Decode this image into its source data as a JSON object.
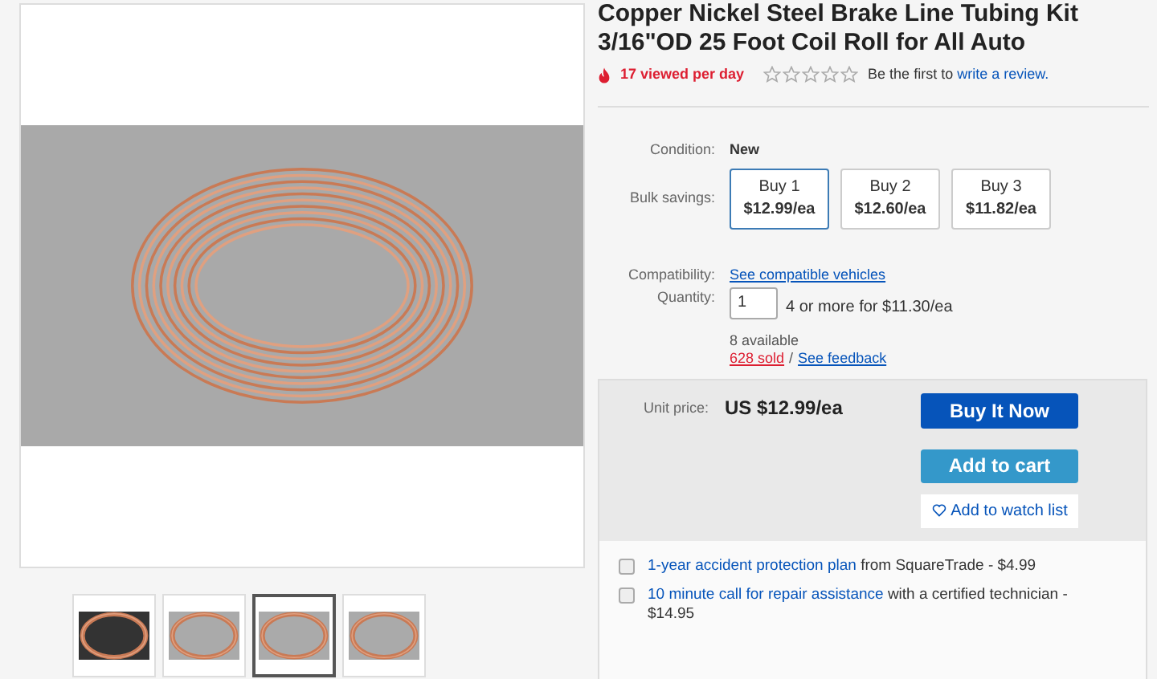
{
  "title": "Copper Nickel Steel Brake Line Tubing Kit 3/16\"OD 25 Foot Coil Roll for All Auto",
  "views": "17 viewed per day",
  "stars": 0,
  "review_prefix": "Be the first to",
  "review_link": "write a review.",
  "condition": {
    "label": "Condition:",
    "value": "New"
  },
  "bulk": {
    "label": "Bulk savings:",
    "options": [
      {
        "qty": "Buy 1",
        "price": "$12.99/ea",
        "selected": true
      },
      {
        "qty": "Buy 2",
        "price": "$12.60/ea",
        "selected": false
      },
      {
        "qty": "Buy 3",
        "price": "$11.82/ea",
        "selected": false
      }
    ]
  },
  "compatibility": {
    "label": "Compatibility:",
    "link": "See compatible vehicles"
  },
  "quantity": {
    "label": "Quantity:",
    "value": "1",
    "note": "4 or more for $11.30/ea"
  },
  "available": "8 available",
  "sold": "628 sold",
  "separator": "/",
  "feedback": "See feedback",
  "unit_price": {
    "label": "Unit price:",
    "value": "US $12.99/ea"
  },
  "buttons": {
    "buy": "Buy It Now",
    "cart": "Add to cart",
    "watch": "Add to watch list"
  },
  "addons": [
    {
      "link": "1-year accident protection plan",
      "text": "from SquareTrade - $4.99",
      "checked": false
    },
    {
      "link": "10 minute call for repair assistance",
      "text": "with a certified technician - $14.95",
      "checked": false
    }
  ],
  "thumbnails": [
    {
      "selected": false
    },
    {
      "selected": false
    },
    {
      "selected": true
    },
    {
      "selected": false
    }
  ]
}
